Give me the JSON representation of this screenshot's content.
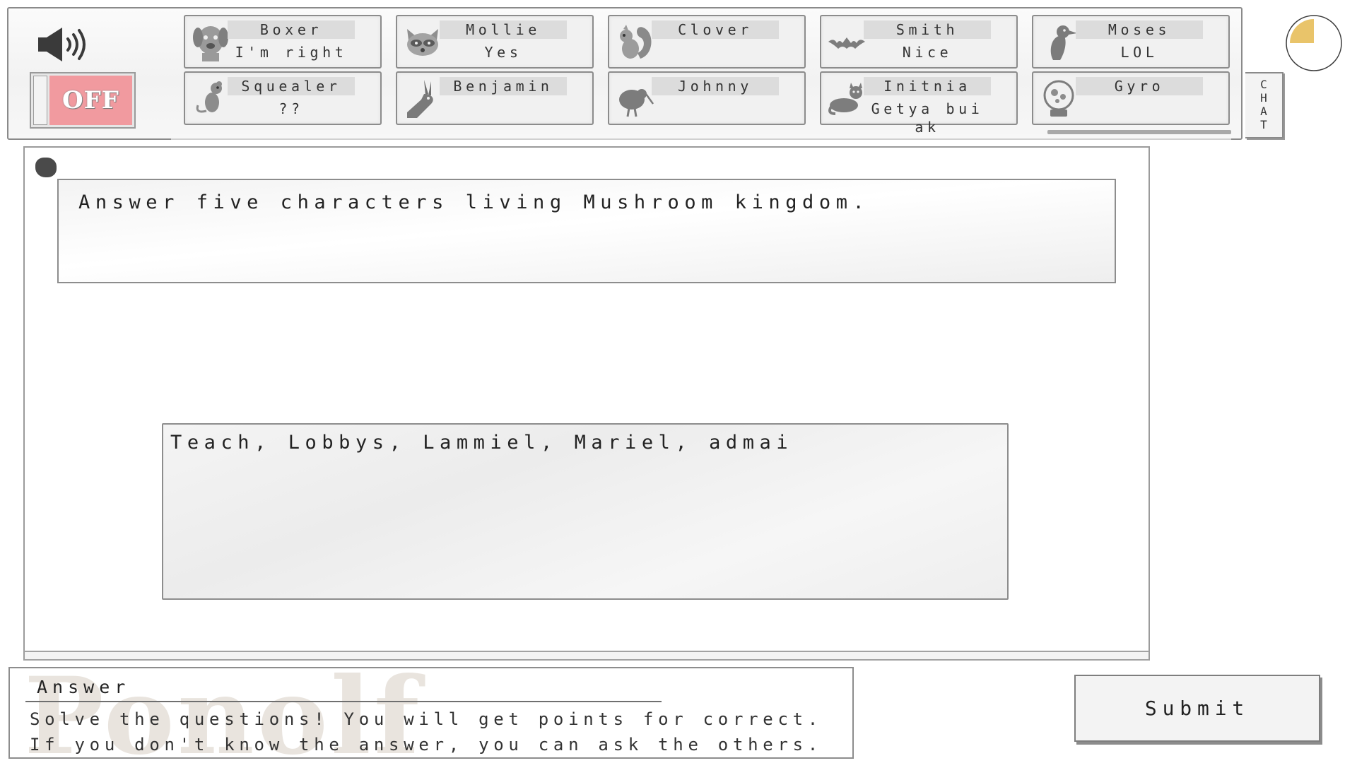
{
  "sound": {
    "toggle_label": "OFF",
    "icon": "speaker-icon"
  },
  "players": [
    {
      "name": "Boxer",
      "status": "I'm right",
      "icon": "dog-icon"
    },
    {
      "name": "Mollie",
      "status": "Yes",
      "icon": "raccoon-icon"
    },
    {
      "name": "Clover",
      "status": "",
      "icon": "squirrel-icon"
    },
    {
      "name": "Smith",
      "status": "Nice",
      "icon": "bat-icon"
    },
    {
      "name": "Moses",
      "status": "LOL",
      "icon": "crow-icon"
    },
    {
      "name": "Squealer",
      "status": "??",
      "icon": "rat-icon"
    },
    {
      "name": "Benjamin",
      "status": "",
      "icon": "donkey-icon"
    },
    {
      "name": "Johnny",
      "status": "",
      "icon": "kiwi-icon"
    },
    {
      "name": "Initnia",
      "status": "Getya bui ak",
      "icon": "cat-icon"
    },
    {
      "name": "Gyro",
      "status": "",
      "icon": "orb-icon"
    }
  ],
  "chat_tab": {
    "label": "CHAT"
  },
  "timer": {
    "elapsed_fraction": 0.25
  },
  "question": {
    "text": "Answer five characters living Mushroom kingdom."
  },
  "answer": {
    "text": "Teach, Lobbys, Lammiel, Mariel, admai"
  },
  "hint": {
    "title": "Answer",
    "text": "Solve the questions! You will get points for correct. If you don't know the answer, you can ask the others.",
    "watermark": "Ponolf"
  },
  "submit": {
    "label": "Submit"
  },
  "colors": {
    "toggle_off": "#f19a9f",
    "timer_fill": "#e9c46a",
    "record_dot": "#4a4a4a"
  }
}
